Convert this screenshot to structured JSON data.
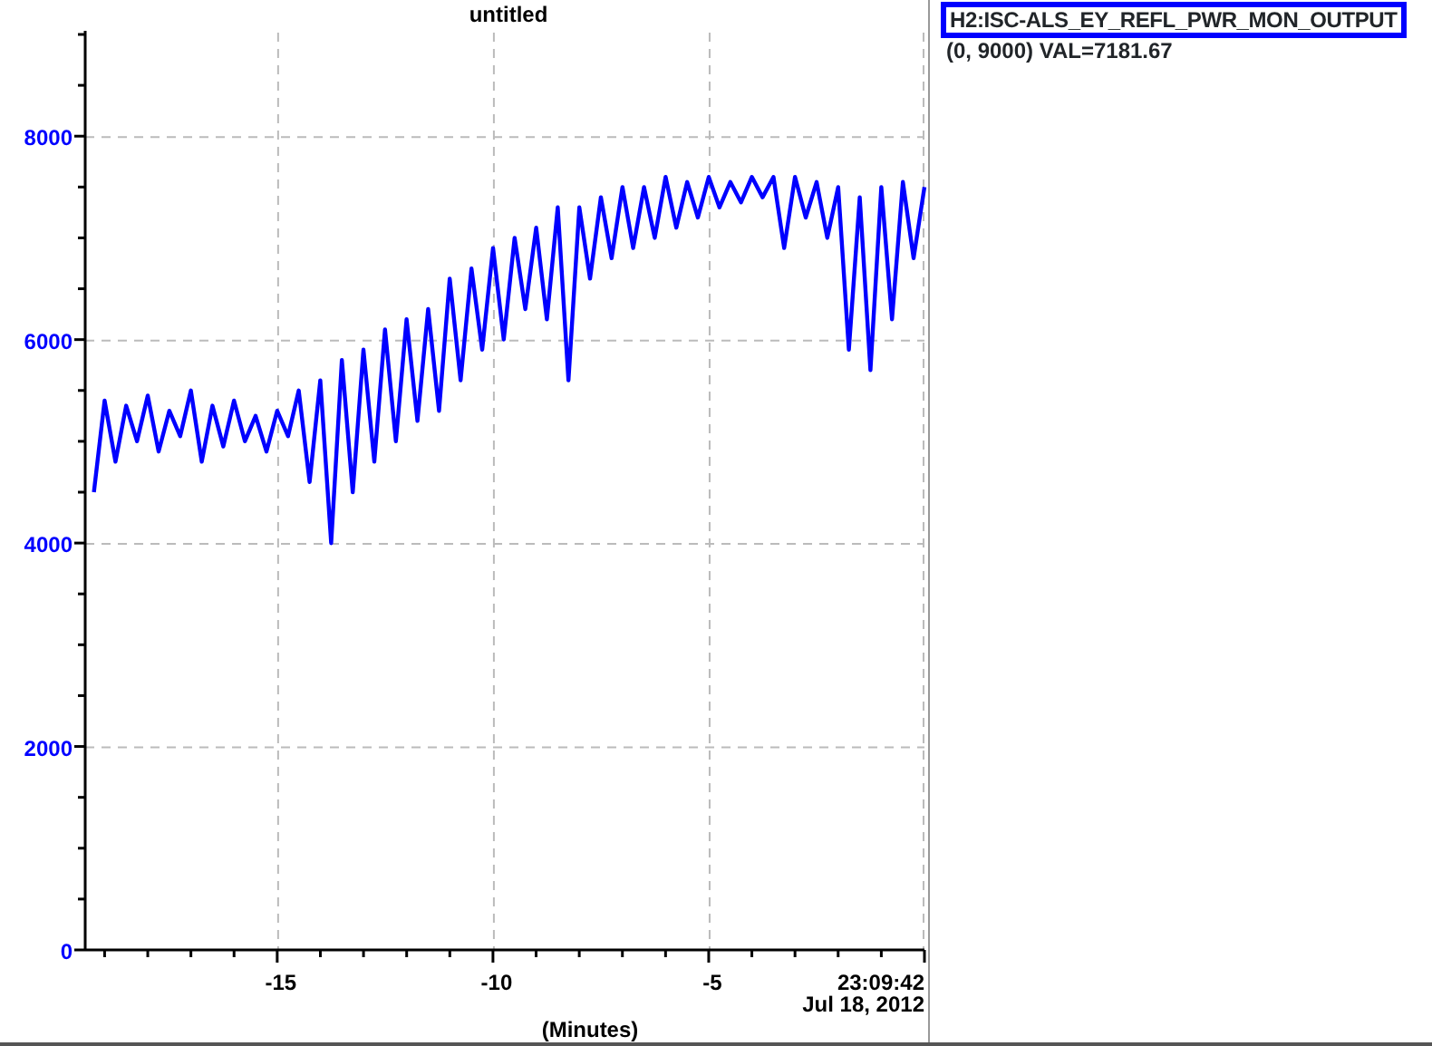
{
  "plot": {
    "chart_data": {
      "type": "line",
      "title": "untitled",
      "xlabel": "(Minutes)",
      "xlim": [
        -19.45,
        0
      ],
      "ylim": [
        0,
        9000
      ],
      "x": [
        -19.25,
        -19,
        -18.75,
        -18.5,
        -18.25,
        -18,
        -17.75,
        -17.5,
        -17.25,
        -17,
        -16.75,
        -16.5,
        -16.25,
        -16,
        -15.75,
        -15.5,
        -15.25,
        -15,
        -14.75,
        -14.5,
        -14.25,
        -14,
        -13.75,
        -13.5,
        -13.25,
        -13,
        -12.75,
        -12.5,
        -12.25,
        -12,
        -11.75,
        -11.5,
        -11.25,
        -11,
        -10.75,
        -10.5,
        -10.25,
        -10,
        -9.75,
        -9.5,
        -9.25,
        -9,
        -8.75,
        -8.5,
        -8.25,
        -8,
        -7.75,
        -7.5,
        -7.25,
        -7,
        -6.75,
        -6.5,
        -6.25,
        -6,
        -5.75,
        -5.5,
        -5.25,
        -5,
        -4.75,
        -4.5,
        -4.25,
        -4,
        -3.75,
        -3.5,
        -3.25,
        -3,
        -2.75,
        -2.5,
        -2.25,
        -2,
        -1.75,
        -1.5,
        -1.25,
        -1,
        -0.75,
        -0.5,
        -0.25,
        0
      ],
      "xticks": [
        {
          "value": -15,
          "label": "-15"
        },
        {
          "value": -10,
          "label": "-10"
        },
        {
          "value": -5,
          "label": "-5"
        }
      ],
      "grid": true,
      "yticks": [
        0,
        2000,
        4000,
        6000,
        8000
      ],
      "series": [
        {
          "name": "H2:ISC-ALS_EY_REFL_PWR_MON_OUTPUT",
          "color": "#0000ff",
          "values": [
            4500,
            5400,
            4800,
            5350,
            5000,
            5450,
            4900,
            5300,
            5050,
            5500,
            4800,
            5350,
            4950,
            5400,
            5000,
            5250,
            4900,
            5300,
            5050,
            5500,
            4600,
            5600,
            4000,
            5800,
            4500,
            5900,
            4800,
            6100,
            5000,
            6200,
            5200,
            6300,
            5300,
            6600,
            5600,
            6700,
            5900,
            6900,
            6000,
            7000,
            6300,
            7100,
            6200,
            7300,
            5600,
            7300,
            6600,
            7400,
            6800,
            7500,
            6900,
            7500,
            7000,
            7600,
            7100,
            7550,
            7200,
            7600,
            7300,
            7550,
            7350,
            7600,
            7400,
            7600,
            6900,
            7600,
            7200,
            7550,
            7000,
            7500,
            5900,
            7400,
            5700,
            7500,
            6200,
            7550,
            6800,
            7500
          ]
        }
      ]
    },
    "end_time": "23:09:42",
    "date": "Jul 18, 2012"
  },
  "legend": {
    "info": "(0, 9000) VAL=7181.67"
  }
}
